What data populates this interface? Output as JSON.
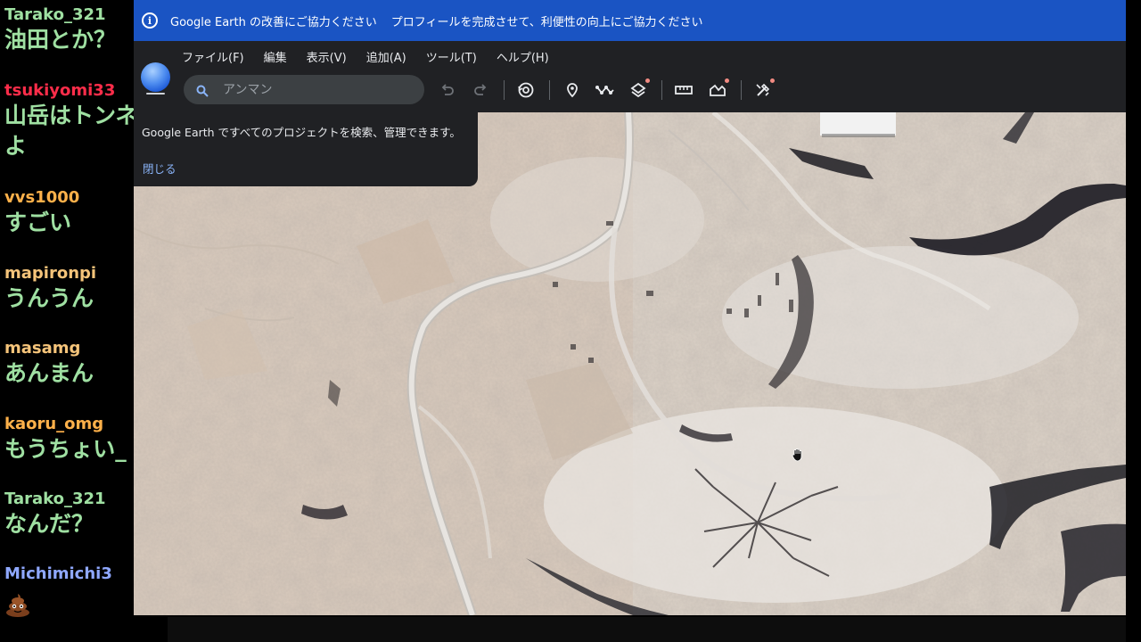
{
  "chat": {
    "messages": [
      {
        "user": "Tarako_321",
        "user_color": "#9fe0a2",
        "text": "油田とか？"
      },
      {
        "user": "tsukiyomi33",
        "user_color": "#ff2d4a",
        "text": "山岳はトンネ",
        "text2": "よ"
      },
      {
        "user": "vvs1000",
        "user_color": "#ffb14a",
        "text": "すごい"
      },
      {
        "user": "mapironpi",
        "user_color": "#f5c47a",
        "text": "うんうん"
      },
      {
        "user": "masamg",
        "user_color": "#f5c47a",
        "text": "あんまん"
      },
      {
        "user": "kaoru_omg",
        "user_color": "#ffb14a",
        "text": "もうちょい_"
      },
      {
        "user": "Tarako_321",
        "user_color": "#9fe0a2",
        "text": "なんだ？"
      },
      {
        "user": "Michimichi3",
        "user_color": "#8fa8ff",
        "text": "",
        "emoji": "poop-emoji"
      }
    ]
  },
  "banner": {
    "text1": "Google Earth の改善にご協力ください",
    "text2": "プロフィールを完成させて、利便性の向上にご協力ください",
    "color": "#1a54c3"
  },
  "menu": {
    "items": [
      "ファイル(F)",
      "編集",
      "表示(V)",
      "追加(A)",
      "ツール(T)",
      "ヘルプ(H)"
    ]
  },
  "search": {
    "placeholder": "アンマン"
  },
  "toolbar": {
    "icons": [
      "undo-icon",
      "redo-icon",
      "history-icon",
      "placemark-icon",
      "path-icon",
      "layers-icon",
      "ruler-icon",
      "chart-icon",
      "settings-icon"
    ]
  },
  "popup": {
    "text": "Google Earth ですべてのプロジェクトを検索、管理できます。",
    "close_label": "閉じる"
  },
  "map": {
    "description_icon": "hand-cursor-icon"
  }
}
